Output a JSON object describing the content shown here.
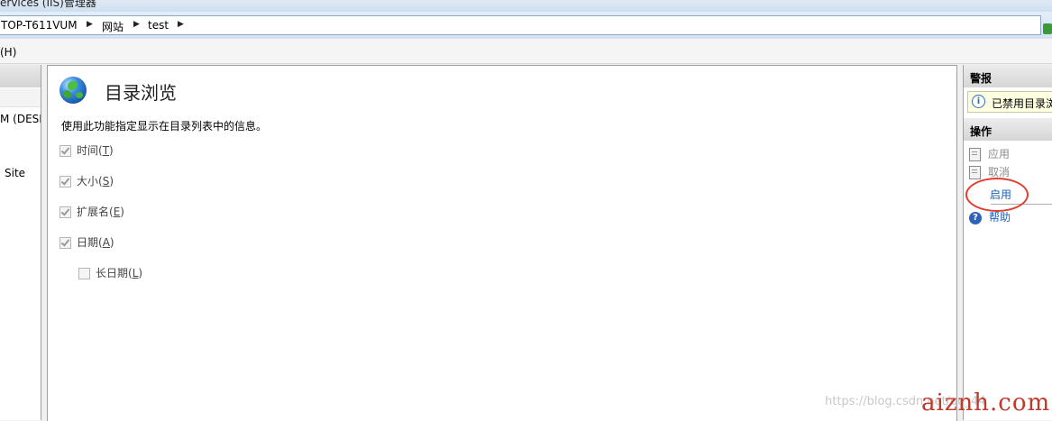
{
  "window": {
    "title": "ervices (IIS)管理器"
  },
  "address_bar": {
    "crumbs": [
      "TOP-T611VUM",
      "网站",
      "test"
    ]
  },
  "menu": {
    "help_label": "(H)"
  },
  "connections": {
    "nodes": [
      "M (DESK",
      "Site"
    ]
  },
  "feature": {
    "title": "目录浏览",
    "description": "使用此功能指定显示在目录列表中的信息。",
    "options": [
      {
        "label": "时间",
        "key": "T",
        "checked": true,
        "enabled": false
      },
      {
        "label": "大小",
        "key": "S",
        "checked": true,
        "enabled": false
      },
      {
        "label": "扩展名",
        "key": "E",
        "checked": true,
        "enabled": false
      },
      {
        "label": "日期",
        "key": "A",
        "checked": true,
        "enabled": false
      },
      {
        "label": "长日期",
        "key": "L",
        "checked": false,
        "enabled": false
      }
    ]
  },
  "actions_pane": {
    "alerts_header": "警报",
    "alert_text": "已禁用目录浏",
    "actions_header": "操作",
    "apply": "应用",
    "cancel": "取消",
    "enable": "启用",
    "help": "帮助"
  },
  "watermark": {
    "url": "https://blog.csdn.net/qq_44",
    "site": "aiznh.com"
  },
  "colors": {
    "link": "#1f5fb7",
    "annotation": "#e23b30",
    "disabled": "#8c8c8c"
  }
}
